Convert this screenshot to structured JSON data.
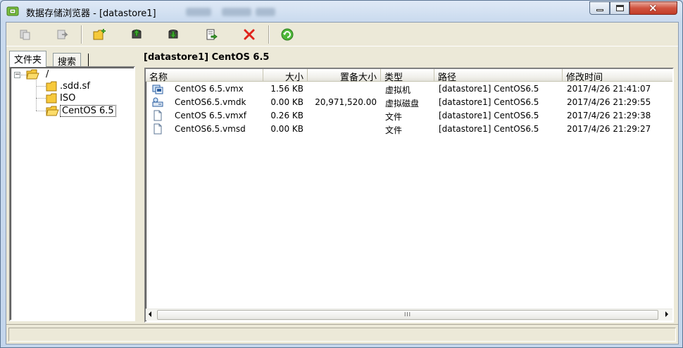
{
  "window": {
    "title": "数据存储浏览器 - [datastore1]",
    "controls": {
      "minimize": "minimize",
      "maximize": "maximize",
      "close": "×"
    }
  },
  "toolbar": {
    "buttons": [
      {
        "icon": "copy-icon"
      },
      {
        "icon": "move-icon"
      },
      {
        "icon": "new-folder-icon"
      },
      {
        "icon": "upload-icon"
      },
      {
        "icon": "download-icon"
      },
      {
        "icon": "register-vm-icon"
      },
      {
        "icon": "delete-icon"
      },
      {
        "icon": "refresh-icon"
      }
    ]
  },
  "left_pane": {
    "tabs": [
      "文件夹",
      "搜索"
    ],
    "tree": {
      "root": "/",
      "children": [
        ".sdd.sf",
        "ISO",
        "CentOS 6.5"
      ],
      "selected": "CentOS 6.5"
    }
  },
  "right_pane": {
    "path_title": "[datastore1] CentOS 6.5",
    "columns": [
      "名称",
      "大小",
      "置备大小",
      "类型",
      "路径",
      "修改时间"
    ],
    "rows": [
      {
        "icon": "vm-config-icon",
        "name": "CentOS 6.5.vmx",
        "size": "1.56 KB",
        "provisioned": "",
        "type": "虚拟机",
        "path": "[datastore1] CentOS6.5",
        "modified": "2017/4/26 21:41:07"
      },
      {
        "icon": "virtual-disk-icon",
        "name": "CentOS6.5.vmdk",
        "size": "0.00 KB",
        "provisioned": "20,971,520.00",
        "type": "虚拟磁盘",
        "path": "[datastore1] CentOS6.5",
        "modified": "2017/4/26 21:29:55"
      },
      {
        "icon": "file-icon",
        "name": "CentOS 6.5.vmxf",
        "size": "0.26 KB",
        "provisioned": "",
        "type": "文件",
        "path": "[datastore1] CentOS6.5",
        "modified": "2017/4/26 21:29:38"
      },
      {
        "icon": "file-icon",
        "name": "CentOS6.5.vmsd",
        "size": "0.00 KB",
        "provisioned": "",
        "type": "文件",
        "path": "[datastore1] CentOS6.5",
        "modified": "2017/4/26 21:29:27"
      }
    ],
    "scrollbar_grip": "III"
  }
}
